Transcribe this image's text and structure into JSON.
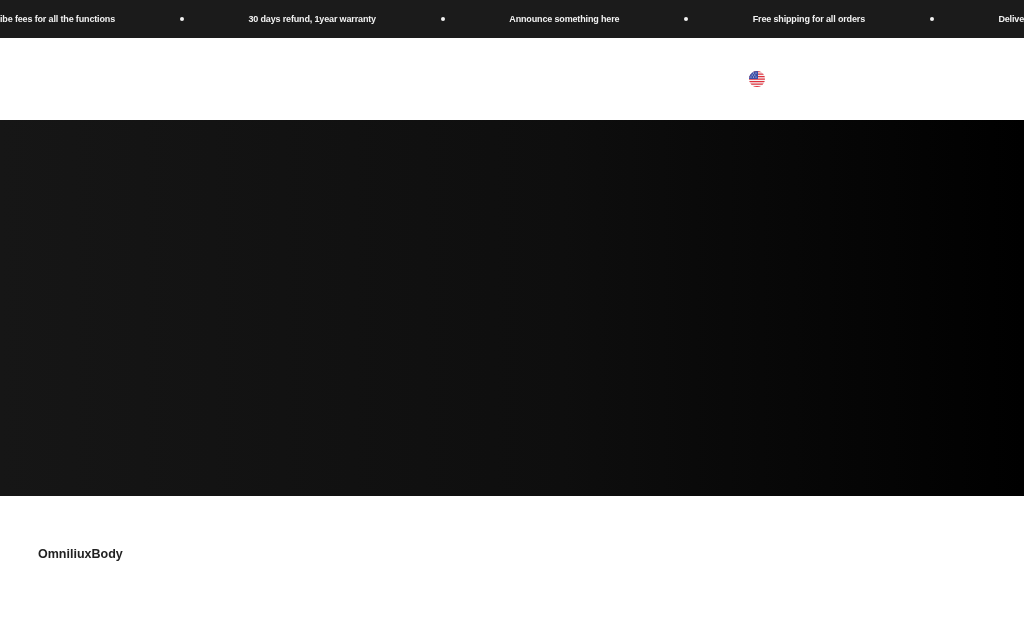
{
  "announcement_bar": {
    "items": [
      "ibe fees for all the functions",
      "30 days refund, 1year warranty",
      "Announce something here",
      "Free shipping for all orders",
      "Delive"
    ]
  },
  "footer": {
    "brand": "OmniliuxBody"
  }
}
